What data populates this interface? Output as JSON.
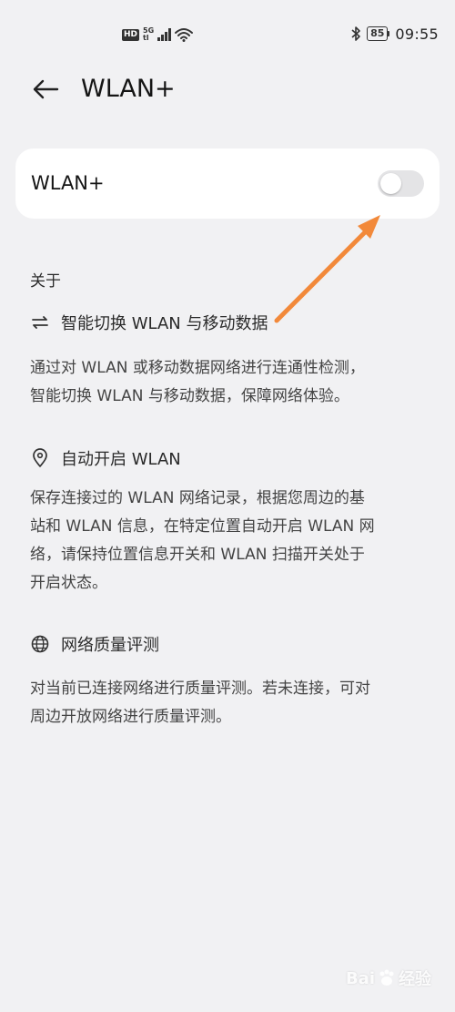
{
  "status_bar": {
    "hd": "HD",
    "net_type_top": "5G",
    "net_type_bottom": "tl",
    "battery": "85",
    "time": "09:55",
    "icons": [
      "signal-icon",
      "wifi-icon",
      "bluetooth-icon",
      "battery-icon"
    ]
  },
  "header": {
    "title": "WLAN+"
  },
  "toggle_card": {
    "label": "WLAN+",
    "enabled": false
  },
  "about": {
    "heading": "关于",
    "features": [
      {
        "icon": "switch-icon",
        "title": "智能切换 WLAN 与移动数据",
        "desc_lines": [
          "通过对 WLAN 或移动数据网络进行连通性检测，",
          "智能切换 WLAN 与移动数据，保障网络体验。"
        ]
      },
      {
        "icon": "location-icon",
        "title": "自动开启 WLAN",
        "desc_lines": [
          "保存连接过的 WLAN 网络记录，根据您周边的基",
          "站和 WLAN 信息，在特定位置自动开启 WLAN 网",
          "络，请保持位置信息开关和 WLAN 扫描开关处于",
          "开启状态。"
        ]
      },
      {
        "icon": "globe-icon",
        "title": "网络质量评测",
        "desc_lines": [
          "对当前已连接网络进行质量评测。若未连接，可对",
          "周边开放网络进行质量评测。"
        ]
      }
    ]
  },
  "annotation": {
    "arrow_color": "#f2893a"
  },
  "watermark": {
    "text": "Bai",
    "text2": "经验"
  }
}
